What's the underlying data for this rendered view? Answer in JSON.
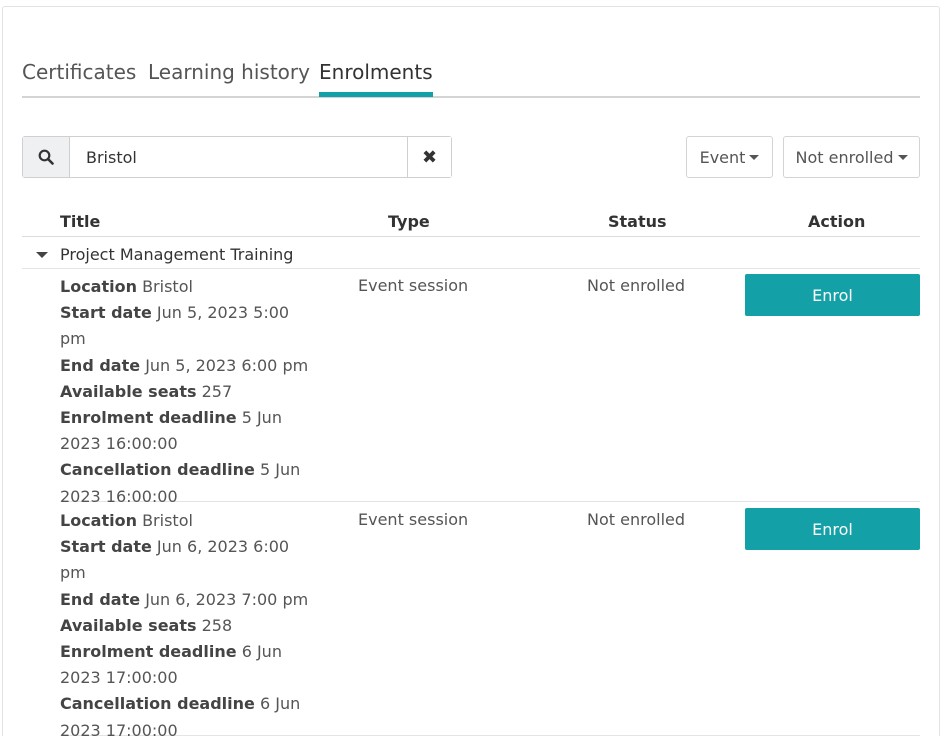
{
  "tabs": [
    {
      "label": "Certificates"
    },
    {
      "label": "Learning history"
    },
    {
      "label": "Enrolments"
    }
  ],
  "search": {
    "value": "Bristol"
  },
  "filters": {
    "type_label": "Event",
    "status_label": "Not enrolled"
  },
  "table": {
    "headers": {
      "title": "Title",
      "type": "Type",
      "status": "Status",
      "action": "Action"
    },
    "group_title": "Project Management Training",
    "field_labels": {
      "location": "Location",
      "start": "Start date",
      "end": "End date",
      "seats": "Available seats",
      "enrol_deadline": "Enrolment deadline",
      "cancel_deadline": "Cancellation deadline"
    },
    "rows": [
      {
        "location": "Bristol",
        "start": "Jun 5, 2023 5:00 pm",
        "end": "Jun 5, 2023 6:00 pm",
        "seats": "257",
        "enrol_deadline": "5 Jun 2023 16:00:00",
        "cancel_deadline": "5 Jun 2023 16:00:00",
        "type": "Event session",
        "status": "Not enrolled",
        "action": "Enrol"
      },
      {
        "location": "Bristol",
        "start": "Jun 6, 2023 6:00 pm",
        "end": "Jun 6, 2023 7:00 pm",
        "seats": "258",
        "enrol_deadline": "6 Jun 2023 17:00:00",
        "cancel_deadline": "6 Jun 2023 17:00:00",
        "type": "Event session",
        "status": "Not enrolled",
        "action": "Enrol"
      }
    ]
  },
  "colors": {
    "accent": "#13a0a6"
  }
}
